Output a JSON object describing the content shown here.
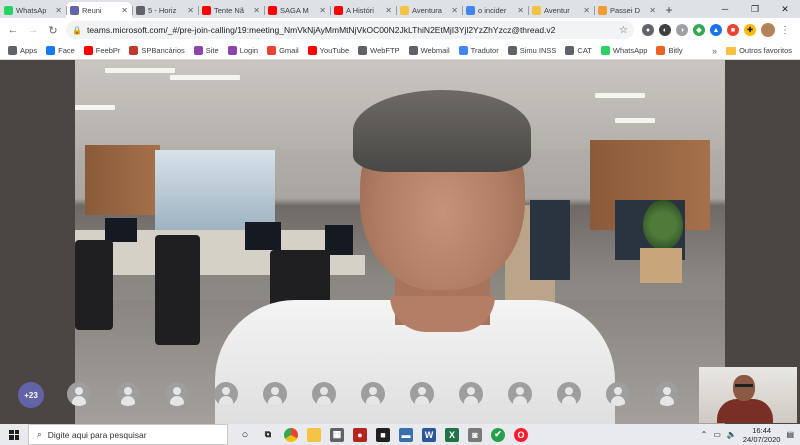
{
  "tabs": [
    {
      "title": "WhatsAp",
      "icon": "whatsapp-icon",
      "color": "#25d366",
      "active": false
    },
    {
      "title": "Reuni",
      "icon": "teams-icon",
      "color": "#6264a7",
      "active": true
    },
    {
      "title": "5 - Horiz",
      "icon": "globe-icon",
      "color": "#5f6368",
      "active": false
    },
    {
      "title": "Tente Nã",
      "icon": "youtube-icon",
      "color": "#ff0000",
      "active": false
    },
    {
      "title": "SAGA M",
      "icon": "youtube-icon",
      "color": "#ff0000",
      "active": false
    },
    {
      "title": "A Históri",
      "icon": "youtube-icon",
      "color": "#ff0000",
      "active": false
    },
    {
      "title": "Aventura",
      "icon": "yellow-m-icon",
      "color": "#f5c242",
      "active": false
    },
    {
      "title": "o incider",
      "icon": "google-icon",
      "color": "#4285f4",
      "active": false
    },
    {
      "title": "Aventur",
      "icon": "yellow-m-icon",
      "color": "#f5c242",
      "active": false
    },
    {
      "title": "Passei D",
      "icon": "orange-icon",
      "color": "#f29a35",
      "active": false
    }
  ],
  "url": "teams.microsoft.com/_#/pre-join-calling/19:meeting_NmVkNjAyMmMtNjVkOC00N2JkLThiN2EtMjI3Yjl2YzZhYzcz@thread.v2",
  "bookmarks": [
    {
      "label": "Apps",
      "icon": "apps-grid-icon",
      "color": "#5f6368"
    },
    {
      "label": "Face",
      "icon": "facebook-icon",
      "color": "#1877f2"
    },
    {
      "label": "FeebPr",
      "icon": "youtube-icon",
      "color": "#ff0000"
    },
    {
      "label": "SPBancários",
      "icon": "spbancarios-icon",
      "color": "#c0392b"
    },
    {
      "label": "Site",
      "icon": "site-icon",
      "color": "#8e44ad"
    },
    {
      "label": "Login",
      "icon": "login-icon",
      "color": "#8e44ad"
    },
    {
      "label": "Gmail",
      "icon": "gmail-icon",
      "color": "#ea4335"
    },
    {
      "label": "YouTube",
      "icon": "youtube-icon",
      "color": "#ff0000"
    },
    {
      "label": "WebFTP",
      "icon": "webftp-icon",
      "color": "#5f6368"
    },
    {
      "label": "Webmail",
      "icon": "webmail-icon",
      "color": "#5f6368"
    },
    {
      "label": "Tradutor",
      "icon": "translate-icon",
      "color": "#4285f4"
    },
    {
      "label": "Simu INSS",
      "icon": "folder-icon",
      "color": "#5f6368"
    },
    {
      "label": "CAT",
      "icon": "globe-icon",
      "color": "#5f6368"
    },
    {
      "label": "WhatsApp",
      "icon": "whatsapp-icon",
      "color": "#25d366"
    },
    {
      "label": "Bitly",
      "icon": "bitly-icon",
      "color": "#ee6123"
    }
  ],
  "other_bookmarks": "Outros favoritos",
  "participants": {
    "count_label": "+23",
    "avatars": 13
  },
  "taskbar": {
    "search_placeholder": "Digite aqui para pesquisar",
    "time": "16:44",
    "date": "24/07/2020"
  },
  "colors": {
    "teams_purple": "#6264a7",
    "tabstrip_bg": "#dee1e6",
    "taskbar_bg": "#e8eaed"
  }
}
